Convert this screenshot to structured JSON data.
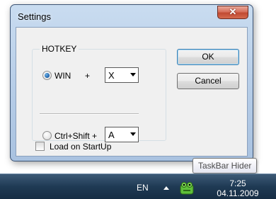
{
  "dialog": {
    "title": "Settings",
    "close_glyph": "✕",
    "hotkey_group": {
      "label": "HOTKEY",
      "win_option": {
        "label": "WIN",
        "plus": "+",
        "selected": true,
        "key_value": "X"
      },
      "ctrlshift_option": {
        "label": "Ctrl+Shift +",
        "selected": false,
        "key_value": "A"
      }
    },
    "ok_label": "OK",
    "cancel_label": "Cancel",
    "load_on_startup": {
      "label": "Load on StartUp",
      "checked": false
    }
  },
  "taskbar": {
    "language": "EN",
    "clock_time": "7:25",
    "clock_date": "04.11.2009",
    "tray_app": "taskbar-hider-icon"
  },
  "tooltip": {
    "text": "TaskBar Hider"
  }
}
